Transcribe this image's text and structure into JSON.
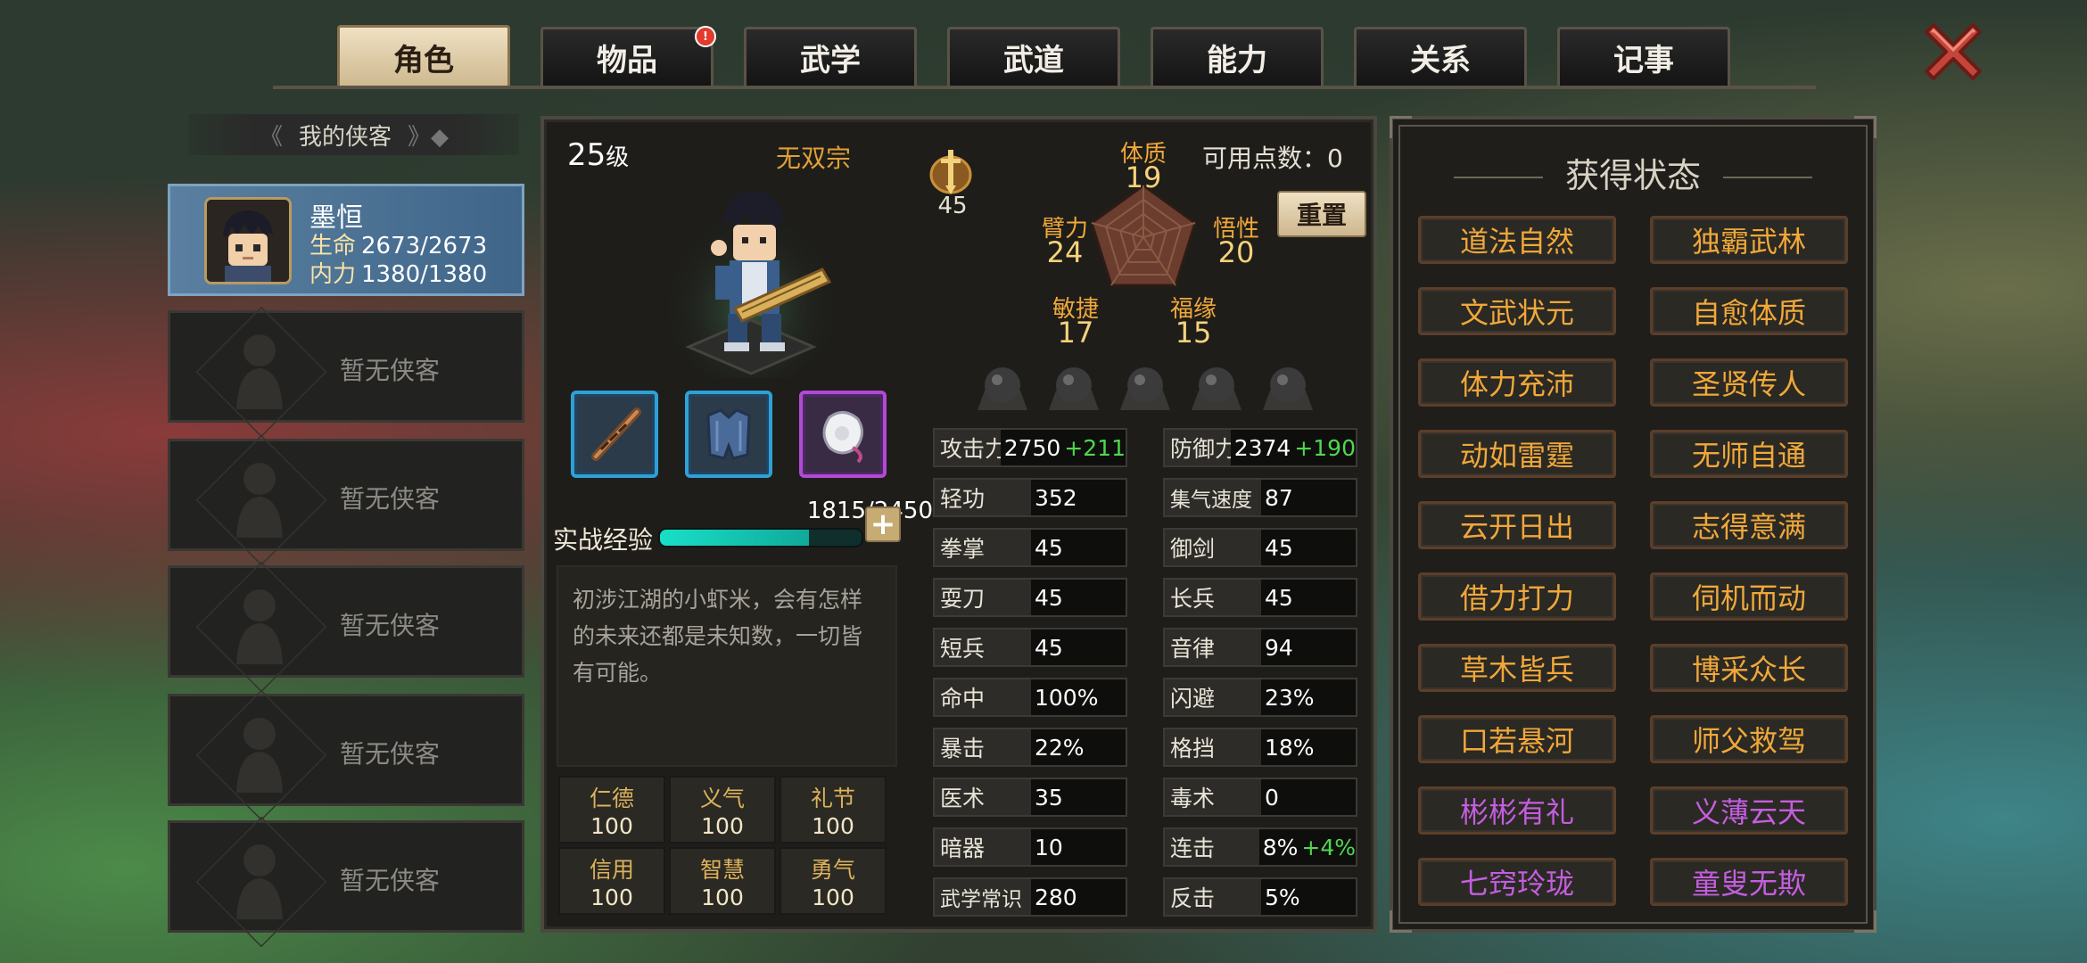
{
  "tabs": [
    {
      "label": "角色",
      "active": true,
      "badge": ""
    },
    {
      "label": "物品",
      "active": false,
      "badge": "!"
    },
    {
      "label": "武学",
      "active": false,
      "badge": ""
    },
    {
      "label": "武道",
      "active": false,
      "badge": ""
    },
    {
      "label": "能力",
      "active": false,
      "badge": ""
    },
    {
      "label": "关系",
      "active": false,
      "badge": ""
    },
    {
      "label": "记事",
      "active": false,
      "badge": ""
    }
  ],
  "left_panel": {
    "header": "我的侠客",
    "hero": {
      "name": "墨恒",
      "hp_label": "生命",
      "hp": "2673/2673",
      "mp_label": "内力",
      "mp": "1380/1380"
    },
    "empty_slots": [
      "暂无侠客",
      "暂无侠客",
      "暂无侠客",
      "暂无侠客",
      "暂无侠客"
    ]
  },
  "character": {
    "level": "25",
    "level_suffix": "级",
    "sect": "无双宗",
    "medal_icon": "sword-medal-icon",
    "medal_value": "45",
    "points_label": "可用点数：",
    "points_value": "0",
    "reset_label": "重置",
    "attributes": {
      "tizhi": {
        "name": "体质",
        "value": "19"
      },
      "wuxing": {
        "name": "悟性",
        "value": "20"
      },
      "fuyuan": {
        "name": "福缘",
        "value": "15"
      },
      "minjie": {
        "name": "敏捷",
        "value": "17"
      },
      "bili": {
        "name": "臂力",
        "value": "24"
      }
    },
    "equipment": [
      {
        "icon": "bow-icon",
        "rarity": "blue"
      },
      {
        "icon": "armor-icon",
        "rarity": "blue"
      },
      {
        "icon": "jade-pendant-icon",
        "rarity": "purple"
      }
    ],
    "exp_label": "实战经验",
    "exp_value": "1815/2450",
    "exp_fraction": 0.741,
    "description": "初涉江湖的小虾米，会有怎样的未来还都是未知数，一切皆有可能。",
    "virtues": [
      {
        "name": "仁德",
        "value": "100"
      },
      {
        "name": "义气",
        "value": "100"
      },
      {
        "name": "礼节",
        "value": "100"
      },
      {
        "name": "信用",
        "value": "100"
      },
      {
        "name": "智慧",
        "value": "100"
      },
      {
        "name": "勇气",
        "value": "100"
      }
    ],
    "stats_left": [
      {
        "k": "攻击力",
        "v": "2750",
        "b": "+211"
      },
      {
        "k": "轻功",
        "v": "352",
        "b": ""
      },
      {
        "k": "拳掌",
        "v": "45",
        "b": ""
      },
      {
        "k": "耍刀",
        "v": "45",
        "b": ""
      },
      {
        "k": "短兵",
        "v": "45",
        "b": ""
      },
      {
        "k": "命中",
        "v": "100%",
        "b": ""
      },
      {
        "k": "暴击",
        "v": "22%",
        "b": ""
      },
      {
        "k": "医术",
        "v": "35",
        "b": ""
      },
      {
        "k": "暗器",
        "v": "10",
        "b": ""
      },
      {
        "k": "武学常识",
        "v": "280",
        "b": ""
      }
    ],
    "stats_right": [
      {
        "k": "防御力",
        "v": "2374",
        "b": "+190"
      },
      {
        "k": "集气速度",
        "v": "87",
        "b": ""
      },
      {
        "k": "御剑",
        "v": "45",
        "b": ""
      },
      {
        "k": "长兵",
        "v": "45",
        "b": ""
      },
      {
        "k": "音律",
        "v": "94",
        "b": ""
      },
      {
        "k": "闪避",
        "v": "23%",
        "b": ""
      },
      {
        "k": "格挡",
        "v": "18%",
        "b": ""
      },
      {
        "k": "毒术",
        "v": "0",
        "b": ""
      },
      {
        "k": "连击",
        "v": "8%",
        "b": "+4%"
      },
      {
        "k": "反击",
        "v": "5%",
        "b": ""
      }
    ]
  },
  "status_panel": {
    "title": "获得状态",
    "items": [
      {
        "label": "道法自然",
        "color": "#f0a83a"
      },
      {
        "label": "独霸武林",
        "color": "#f0a83a"
      },
      {
        "label": "文武状元",
        "color": "#f0a83a"
      },
      {
        "label": "自愈体质",
        "color": "#f0a83a"
      },
      {
        "label": "体力充沛",
        "color": "#f0a83a"
      },
      {
        "label": "圣贤传人",
        "color": "#f0a83a"
      },
      {
        "label": "动如雷霆",
        "color": "#f0a83a"
      },
      {
        "label": "无师自通",
        "color": "#f0a83a"
      },
      {
        "label": "云开日出",
        "color": "#f0a83a"
      },
      {
        "label": "志得意满",
        "color": "#f0a83a"
      },
      {
        "label": "借力打力",
        "color": "#f0a83a"
      },
      {
        "label": "伺机而动",
        "color": "#f0a83a"
      },
      {
        "label": "草木皆兵",
        "color": "#f0a83a"
      },
      {
        "label": "博采众长",
        "color": "#f0a83a"
      },
      {
        "label": "口若悬河",
        "color": "#f0a83a"
      },
      {
        "label": "师父救驾",
        "color": "#f0a83a"
      },
      {
        "label": "彬彬有礼",
        "color": "#c45ee0"
      },
      {
        "label": "义薄云天",
        "color": "#c45ee0"
      },
      {
        "label": "七窍玲珑",
        "color": "#c45ee0"
      },
      {
        "label": "童叟无欺",
        "color": "#c45ee0"
      }
    ]
  },
  "close_icon": "close-x-icon"
}
